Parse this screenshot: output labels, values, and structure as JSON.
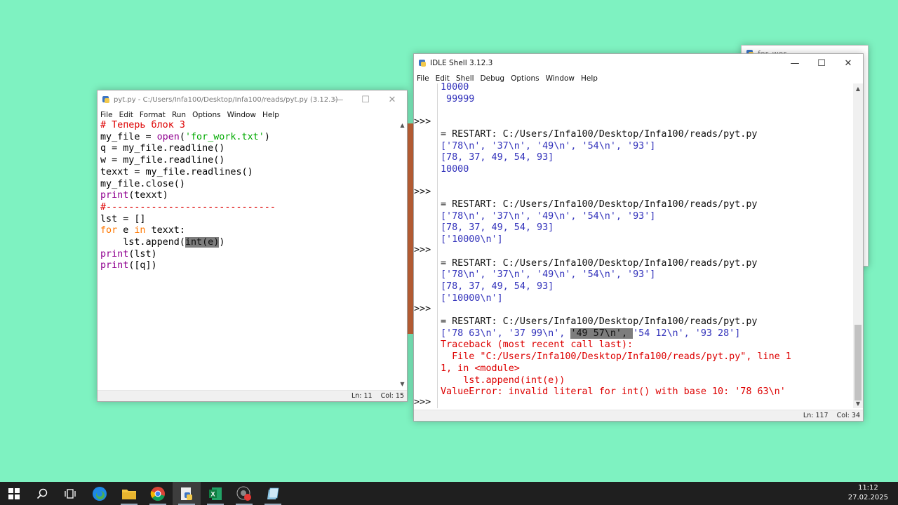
{
  "background_window": {
    "title": "for_wor"
  },
  "editor": {
    "title": "pyt.py - C:/Users/Infa100/Desktop/Infa100/reads/pyt.py (3.12.3)",
    "menu": [
      "File",
      "Edit",
      "Format",
      "Run",
      "Options",
      "Window",
      "Help"
    ],
    "status": {
      "line": "Ln: 11",
      "col": "Col: 15"
    },
    "code": {
      "l1": "# Теперь блок 3",
      "l2_a": "my_file = ",
      "l2_b": "open",
      "l2_c": "(",
      "l2_d": "'for_work.txt'",
      "l2_e": ")",
      "l3": "q = my_file.readline()",
      "l4": "w = my_file.readline()",
      "l5": "texxt = my_file.readlines()",
      "l6": "my_file.close()",
      "l7_a": "print",
      "l7_b": "(texxt)",
      "l8": "#------------------------------",
      "l9": "lst = []",
      "l10_a": "for",
      "l10_b": " e ",
      "l10_c": "in",
      "l10_d": " texxt:",
      "l11_a": "    lst.append(",
      "l11_b": "int(e)",
      "l11_c": ")",
      "l12_a": "print",
      "l12_b": "(lst)",
      "l13_a": "print",
      "l13_b": "([q])"
    }
  },
  "shell": {
    "title": "IDLE Shell 3.12.3",
    "menu": [
      "File",
      "Edit",
      "Shell",
      "Debug",
      "Options",
      "Window",
      "Help"
    ],
    "status": {
      "line": "Ln: 117",
      "col": "Col: 34"
    },
    "prompt": ">>>",
    "lines": {
      "s1": "10000",
      "s2": " 99999",
      "s3": "= RESTART: C:/Users/Infa100/Desktop/Infa100/reads/pyt.py",
      "s4": "['78\\n', '37\\n', '49\\n', '54\\n', '93']",
      "s5": "[78, 37, 49, 54, 93]",
      "s6": "10000",
      "s7": "= RESTART: C:/Users/Infa100/Desktop/Infa100/reads/pyt.py",
      "s8": "['78\\n', '37\\n', '49\\n', '54\\n', '93']",
      "s9": "[78, 37, 49, 54, 93]",
      "s10": "['10000\\n']",
      "s11": "= RESTART: C:/Users/Infa100/Desktop/Infa100/reads/pyt.py",
      "s12": "['78\\n', '37\\n', '49\\n', '54\\n', '93']",
      "s13": "[78, 37, 49, 54, 93]",
      "s14": "['10000\\n']",
      "s15": "= RESTART: C:/Users/Infa100/Desktop/Infa100/reads/pyt.py",
      "s16_a": "['78 63\\n', '37 99\\n', ",
      "s16_b": "'49 57\\n', ",
      "s16_c": "'54 12\\n', '93 28']",
      "s17": "Traceback (most recent call last):",
      "s18": "  File \"C:/Users/Infa100/Desktop/Infa100/reads/pyt.py\", line 1",
      "s19": "1, in <module>",
      "s20": "    lst.append(int(e))",
      "s21": "ValueError: invalid literal for int() with base 10: '78 63\\n'"
    }
  },
  "clock": {
    "time": "11:12",
    "date": "27.02.2025"
  }
}
